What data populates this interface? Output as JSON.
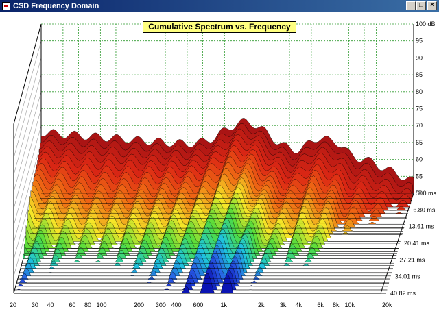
{
  "window": {
    "title": "CSD Frequency Domain",
    "buttons": [
      "minimize",
      "maximize",
      "close"
    ]
  },
  "chart_data": {
    "type": "area",
    "title": "Cumulative Spectrum vs. Frequency",
    "x_tick_labels": [
      "20",
      "30",
      "40",
      "60",
      "80",
      "100",
      "200",
      "300",
      "400",
      "600",
      "1k",
      "2k",
      "3k",
      "4k",
      "6k",
      "8k",
      "10k",
      "20k"
    ],
    "y_tick_labels": [
      "100 dB",
      "95",
      "90",
      "85",
      "80",
      "75",
      "70",
      "65",
      "60",
      "55",
      "50"
    ],
    "y_range": [
      50,
      100
    ],
    "time_tick_labels": [
      "0.0 ms",
      "6.80 ms",
      "13.61 ms",
      "20.41 ms",
      "27.21 ms",
      "34.01 ms",
      "40.82 ms"
    ],
    "time_range_ms": [
      0.0,
      40.82
    ],
    "grid": true,
    "colormap": "red (0 ms) to blue (40.82 ms)"
  }
}
